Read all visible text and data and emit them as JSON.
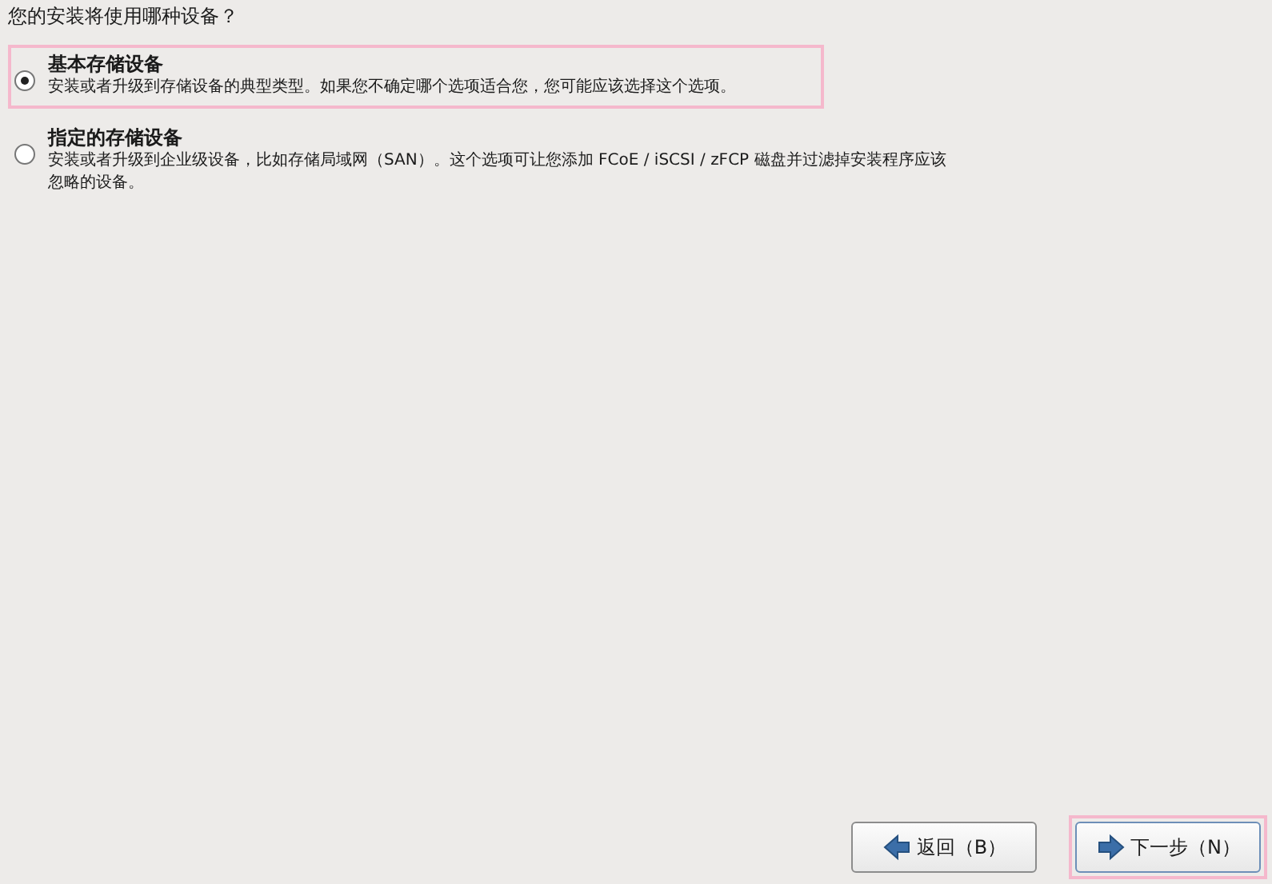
{
  "question": "您的安装将使用哪种设备？",
  "options": [
    {
      "title": "基本存储设备",
      "description": "安装或者升级到存储设备的典型类型。如果您不确定哪个选项适合您，您可能应该选择这个选项。",
      "selected": true,
      "focused": true
    },
    {
      "title": "指定的存储设备",
      "description": "安装或者升级到企业级设备，比如存储局域网（SAN）。这个选项可让您添加 FCoE / iSCSI / zFCP 磁盘并过滤掉安装程序应该忽略的设备。",
      "selected": false,
      "focused": false
    }
  ],
  "buttons": [
    {
      "label": "返回（B）",
      "kind": "back",
      "focused": false
    },
    {
      "label": "下一步（N）",
      "kind": "next",
      "focused": true
    }
  ]
}
